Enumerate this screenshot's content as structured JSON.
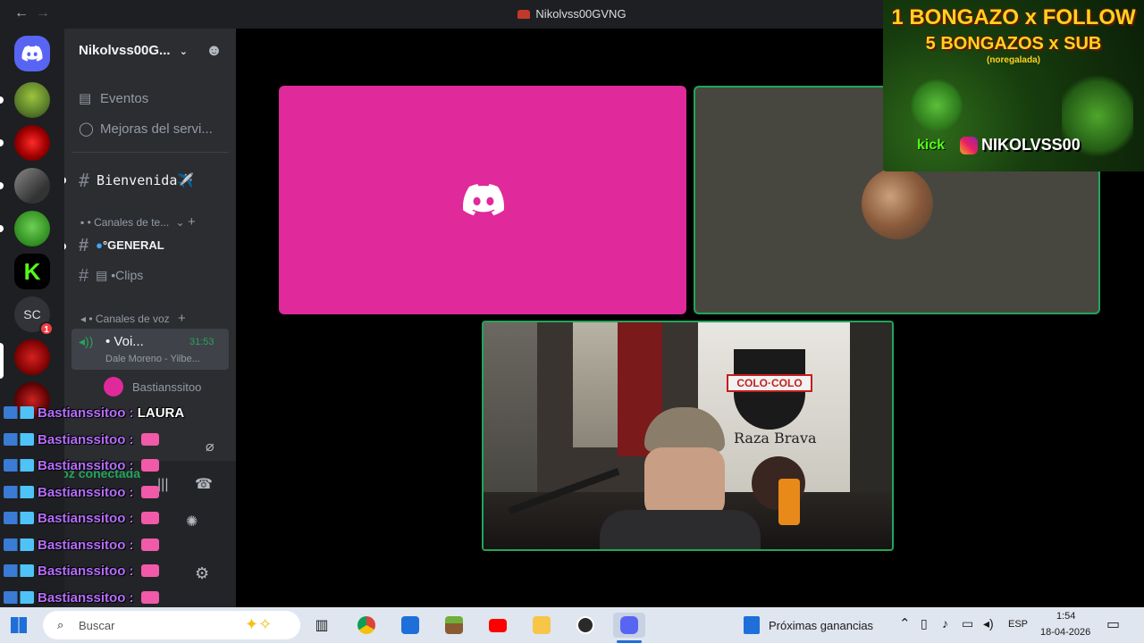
{
  "window": {
    "title": "Nikolvss00GVNG"
  },
  "sidebar": {
    "server_name": "Nikolvss00G...",
    "events_label": "Eventos",
    "boosts_label": "Mejoras del servi...",
    "welcome_channel": "Bienvenida✈️",
    "text_category": "• Canales de te...",
    "general_channel": "°GENERAL",
    "clips_channel": "•Clips",
    "voice_category": "• Canales de voz",
    "voice_channel": "• Voi...",
    "voice_timer": "31:53",
    "voice_activity": "Dale Moreno - Yilbe...",
    "voice_user": "Bastianssitoo",
    "voice_status": "Voz conectada",
    "user_partial": "N..."
  },
  "stream": {
    "promo_line1": "1 BONGAZO x FOLLOW",
    "promo_line2": "5 BONGAZOS x SUB",
    "promo_note": "(noregalada)",
    "promo_kick": "kick",
    "promo_handle": "NIKOLVSS00",
    "banner_text": "COLO·COLO",
    "banner_sub": "Raza Brava"
  },
  "chat_overlay": {
    "messages": [
      {
        "user": "Bastianssitoo",
        "sep": " : ",
        "text": "LAURA"
      },
      {
        "user": "Bastianssitoo",
        "sep": " : ",
        "text": ""
      },
      {
        "user": "Bastianssitoo",
        "sep": " : ",
        "text": ""
      },
      {
        "user": "Bastianssitoo",
        "sep": " : ",
        "text": ""
      },
      {
        "user": "Bastianssitoo",
        "sep": " : ",
        "text": ""
      },
      {
        "user": "Bastianssitoo",
        "sep": " : ",
        "text": ""
      },
      {
        "user": "Bastianssitoo",
        "sep": " : ",
        "text": ""
      },
      {
        "user": "Bastianssitoo",
        "sep": " : ",
        "text": ""
      },
      {
        "user": "Bastianssitoo",
        "sep": "",
        "text": ""
      }
    ]
  },
  "taskbar": {
    "search_placeholder": "Buscar",
    "news_label": "Próximas ganancias",
    "language": "ESP",
    "time": "1:54",
    "date": "18-04-2026"
  },
  "colors": {
    "discord_tile": "#e0299a",
    "accent_green": "#23a55a",
    "blurple": "#5865f2"
  }
}
